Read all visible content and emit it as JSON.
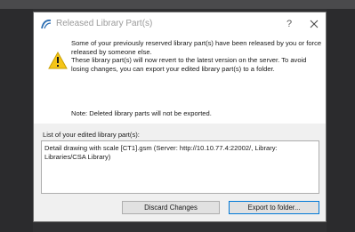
{
  "window": {
    "title": "Released Library Part(s)",
    "help_glyph": "?"
  },
  "message": {
    "text": "Some of your previously reserved library part(s) have been released by you or force released by someone else.\nThese library part(s) will now revert to the latest version on the server. To avoid losing changes, you can export your edited library part(s) to a folder.",
    "note": "Note: Deleted library parts will not be exported."
  },
  "list": {
    "label": "List of your edited library part(s):",
    "items": [
      "Detail drawing with scale [CT1].gsm (Server: http://10.10.77.4:22002/, Library: Libraries/CSA Library)"
    ]
  },
  "buttons": {
    "discard": "Discard Changes",
    "export": "Export to folder..."
  },
  "icons": {
    "app": "archicad-logo-icon",
    "warning": "warning-icon",
    "close": "close-icon"
  },
  "colors": {
    "warning_fill": "#f5c518",
    "accent_border": "#0078d7",
    "backdrop": "#2e2e30"
  }
}
